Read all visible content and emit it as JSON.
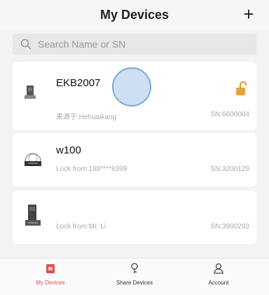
{
  "header": {
    "title": "My Devices",
    "add_label": "+"
  },
  "search": {
    "placeholder": "Search Name or SN",
    "value": ""
  },
  "devices": [
    {
      "name": "EKB2007",
      "owner": "来源于:Hehuaikang",
      "sn": "SN:6600004",
      "icon": "keybox-icon",
      "status_icon": "unlocked-padlock-icon"
    },
    {
      "name": "w100",
      "owner": "Lock from:188****8399",
      "sn": "SN:3200129",
      "icon": "round-lock-icon"
    },
    {
      "name": "",
      "owner": "Lock from:Mr. Li",
      "sn": "SN:3900293",
      "icon": "door-lock-icon"
    }
  ],
  "tabs": [
    {
      "label": "My Devices",
      "icon": "my-devices-icon",
      "active": true
    },
    {
      "label": "Share Devices",
      "icon": "share-icon",
      "active": false
    },
    {
      "label": "Account",
      "icon": "account-icon",
      "active": false
    }
  ],
  "colors": {
    "accent": "#d9534f",
    "lock": "#e8a33a"
  }
}
